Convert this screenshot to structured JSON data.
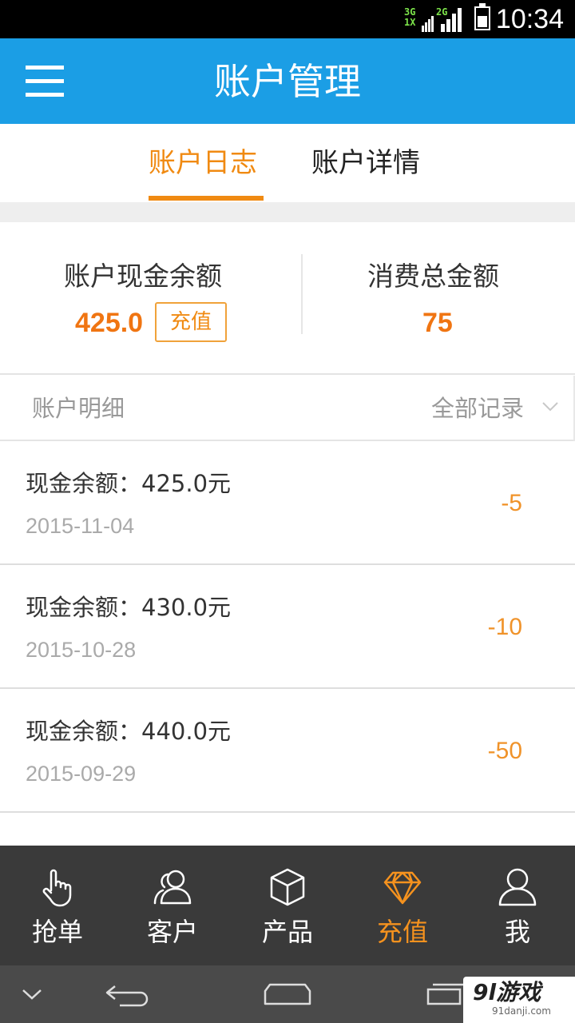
{
  "status_bar": {
    "network_top": "3G",
    "network_top2": "2G",
    "network_bottom": "1X",
    "time": "10:34"
  },
  "header": {
    "title": "账户管理",
    "menu_icon": "hamburger-menu-icon"
  },
  "tabs": [
    {
      "label": "账户日志",
      "active": true
    },
    {
      "label": "账户详情",
      "active": false
    }
  ],
  "summary": {
    "balance_label": "账户现金余额",
    "balance_value": "425.0",
    "recharge_label": "充值",
    "spent_label": "消费总金额",
    "spent_value": "75"
  },
  "detail": {
    "title": "账户明细",
    "filter_label": "全部记录"
  },
  "records": [
    {
      "balance": "现金余额：425.0元",
      "date": "2015-11-04",
      "amount": "-5"
    },
    {
      "balance": "现金余额：430.0元",
      "date": "2015-10-28",
      "amount": "-10"
    },
    {
      "balance": "现金余额：440.0元",
      "date": "2015-09-29",
      "amount": "-50"
    }
  ],
  "bottom_nav": [
    {
      "label": "抢单",
      "icon": "hand-pointer-icon",
      "active": false
    },
    {
      "label": "客户",
      "icon": "customers-icon",
      "active": false
    },
    {
      "label": "产品",
      "icon": "cube-icon",
      "active": false
    },
    {
      "label": "充值",
      "icon": "diamond-icon",
      "active": true
    },
    {
      "label": "我",
      "icon": "user-icon",
      "active": false
    }
  ],
  "watermark": {
    "text": "9l游戏",
    "sub": "91danji.com"
  },
  "colors": {
    "header_blue": "#1b9ee5",
    "accent_orange": "#f08a12",
    "nav_dark": "#3a3a3a"
  }
}
